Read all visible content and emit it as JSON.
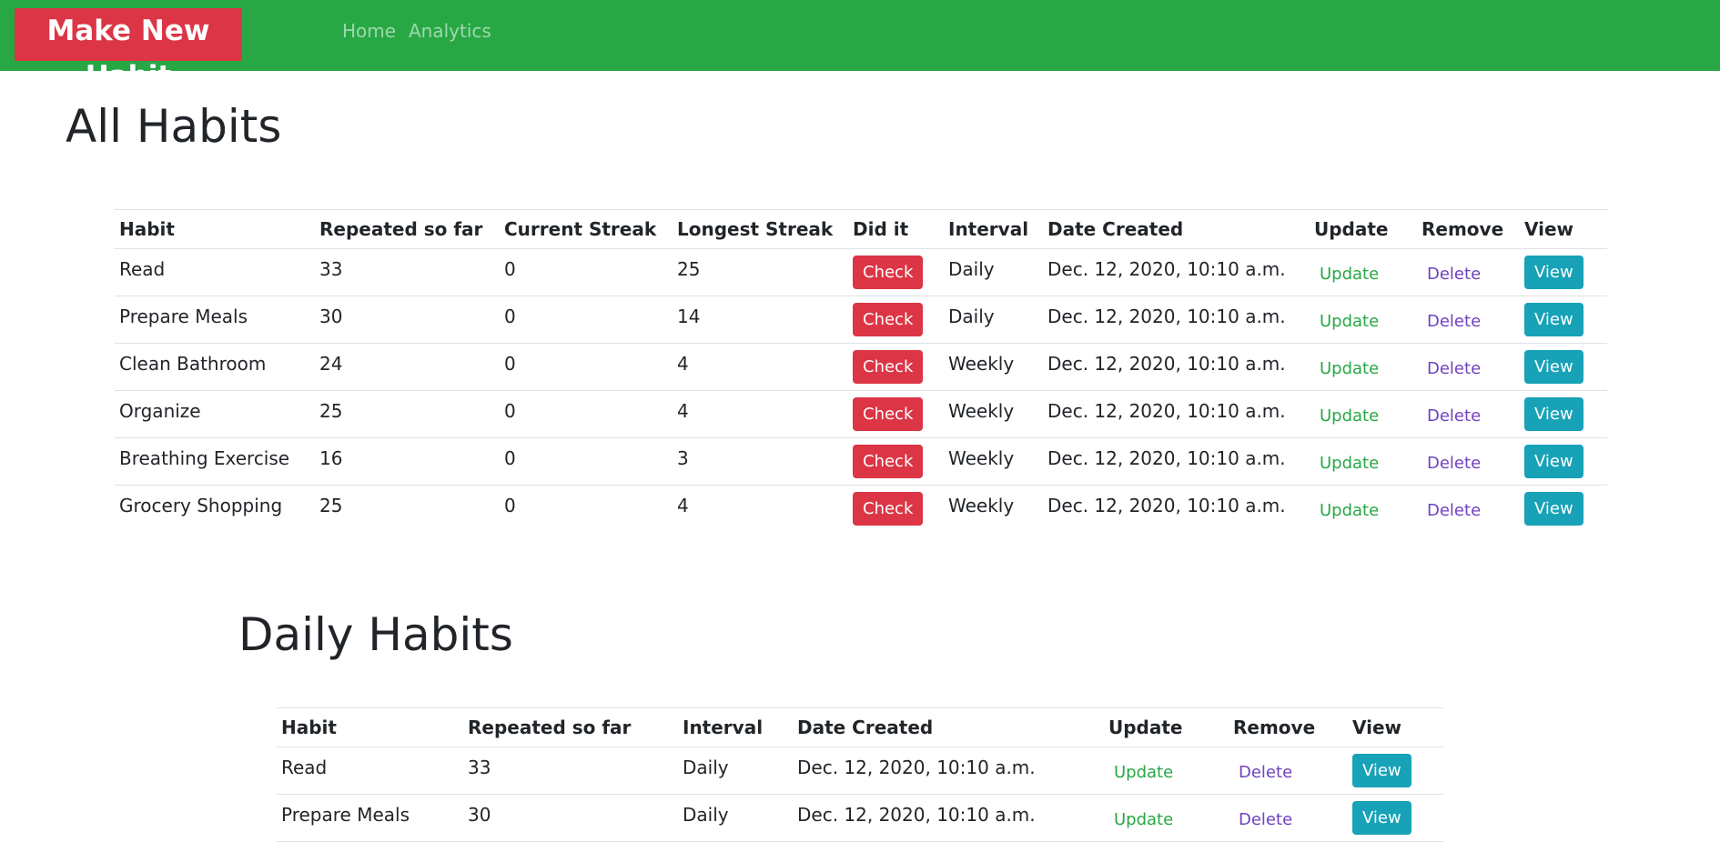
{
  "navbar": {
    "brand": "Make New Habit",
    "links": [
      "Home",
      "Analytics"
    ]
  },
  "all_habits": {
    "title": "All Habits",
    "columns": [
      "Habit",
      "Repeated so far",
      "Current Streak",
      "Longest Streak",
      "Did it",
      "Interval",
      "Date Created",
      "Update",
      "Remove",
      "View"
    ],
    "rows": [
      {
        "habit": "Read",
        "repeated": "33",
        "current": "0",
        "longest": "25",
        "check": "Check",
        "interval": "Daily",
        "created": "Dec. 12, 2020, 10:10 a.m.",
        "update": "Update",
        "delete": "Delete",
        "view": "View"
      },
      {
        "habit": "Prepare Meals",
        "repeated": "30",
        "current": "0",
        "longest": "14",
        "check": "Check",
        "interval": "Daily",
        "created": "Dec. 12, 2020, 10:10 a.m.",
        "update": "Update",
        "delete": "Delete",
        "view": "View"
      },
      {
        "habit": "Clean Bathroom",
        "repeated": "24",
        "current": "0",
        "longest": "4",
        "check": "Check",
        "interval": "Weekly",
        "created": "Dec. 12, 2020, 10:10 a.m.",
        "update": "Update",
        "delete": "Delete",
        "view": "View"
      },
      {
        "habit": "Organize",
        "repeated": "25",
        "current": "0",
        "longest": "4",
        "check": "Check",
        "interval": "Weekly",
        "created": "Dec. 12, 2020, 10:10 a.m.",
        "update": "Update",
        "delete": "Delete",
        "view": "View"
      },
      {
        "habit": "Breathing Exercise",
        "repeated": "16",
        "current": "0",
        "longest": "3",
        "check": "Check",
        "interval": "Weekly",
        "created": "Dec. 12, 2020, 10:10 a.m.",
        "update": "Update",
        "delete": "Delete",
        "view": "View"
      },
      {
        "habit": "Grocery Shopping",
        "repeated": "25",
        "current": "0",
        "longest": "4",
        "check": "Check",
        "interval": "Weekly",
        "created": "Dec. 12, 2020, 10:10 a.m.",
        "update": "Update",
        "delete": "Delete",
        "view": "View"
      }
    ]
  },
  "daily_habits": {
    "title": "Daily Habits",
    "columns": [
      "Habit",
      "Repeated so far",
      "Interval",
      "Date Created",
      "Update",
      "Remove",
      "View"
    ],
    "rows": [
      {
        "habit": "Read",
        "repeated": "33",
        "interval": "Daily",
        "created": "Dec. 12, 2020, 10:10 a.m.",
        "update": "Update",
        "delete": "Delete",
        "view": "View"
      },
      {
        "habit": "Prepare Meals",
        "repeated": "30",
        "interval": "Daily",
        "created": "Dec. 12, 2020, 10:10 a.m.",
        "update": "Update",
        "delete": "Delete",
        "view": "View"
      }
    ]
  },
  "colors": {
    "navbar": "#28a745",
    "brand": "#dc3545",
    "check_button": "#dc3545",
    "view_button": "#17a2b8",
    "update_link": "#28a745",
    "delete_link": "#6f42c1"
  }
}
